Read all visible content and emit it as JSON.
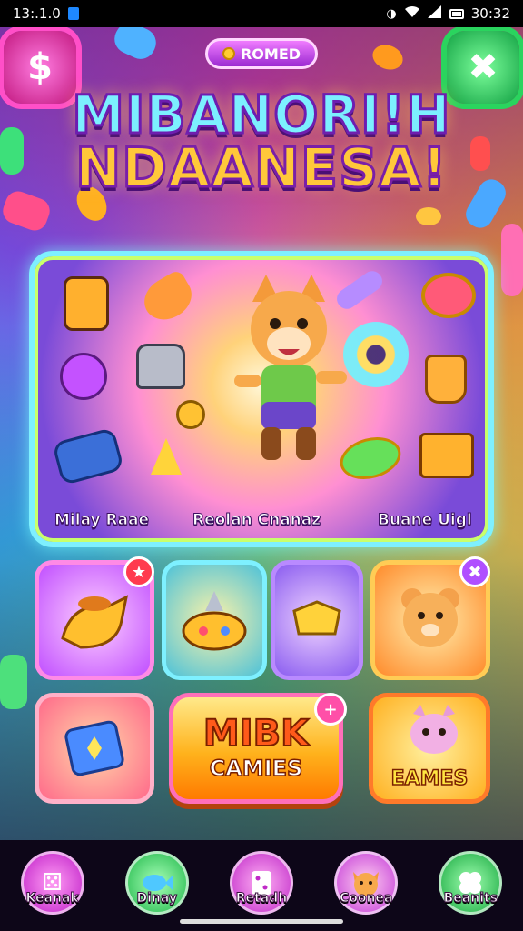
{
  "status_bar": {
    "time_left": "13:.1.0",
    "time_right": "30:32"
  },
  "header": {
    "pill_label": "ROMED",
    "corner_left_symbol": "$",
    "corner_right_symbol": "✖",
    "title_line1": "MIBANORI!H",
    "title_line2": "NDAANESA!"
  },
  "hero": {
    "captions": [
      "Milay Raae",
      "Reolan Cnanaz",
      "Buane Uigl"
    ]
  },
  "tiles": {
    "row1_badge1": "★",
    "row1_badge2": "✖",
    "cta_line1": "MIBK",
    "cta_line2": "CAMIES",
    "cta_badge": "+",
    "games_label": "EAMES"
  },
  "nav": {
    "items": [
      {
        "label": "Keanak",
        "icon": "dice-icon"
      },
      {
        "label": "Dinay",
        "icon": "fish-icon"
      },
      {
        "label": "Retadh",
        "icon": "cards-icon"
      },
      {
        "label": "Coonea",
        "icon": "fox-icon"
      },
      {
        "label": "Beanits",
        "icon": "clover-icon"
      }
    ]
  },
  "colors": {
    "accent_cyan": "#7ef0ff",
    "accent_yellow": "#ffc83a",
    "accent_pink": "#ff4fc8",
    "accent_green": "#2ad45e"
  }
}
